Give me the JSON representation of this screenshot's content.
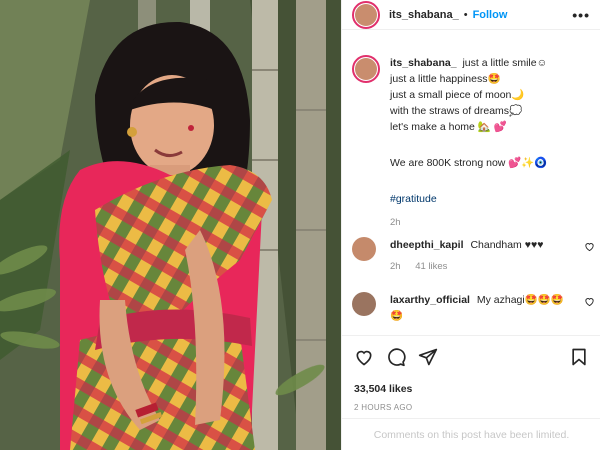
{
  "header": {
    "username": "its_shabana_",
    "separator": "•",
    "follow_label": "Follow",
    "more_icon": "more-horizontal-icon"
  },
  "caption": {
    "username": "its_shabana_",
    "lines": [
      "just a little smile☺",
      "just a little happiness🤩",
      "just a small piece of moon🌙",
      "with the straws of dreams💭",
      "let's make a home 🏡 💕"
    ],
    "strong_line": "We are 800K strong now 💕✨🧿",
    "hashtag": "#gratitude",
    "time": "2h"
  },
  "comments": [
    {
      "username": "dheepthi_kapil",
      "text": "Chandham ♥♥♥",
      "time": "2h",
      "likes": "41 likes"
    },
    {
      "username": "laxarthy_official",
      "text": "My azhagi🤩🤩🤩",
      "extra": "🤩"
    }
  ],
  "actions": {
    "likes": "33,504 likes",
    "ago": "2 HOURS AGO",
    "limited": "Comments on this post have been limited."
  },
  "colors": {
    "follow": "#0095f6",
    "ring": "#e1306c",
    "muted": "#8e8e8e"
  }
}
